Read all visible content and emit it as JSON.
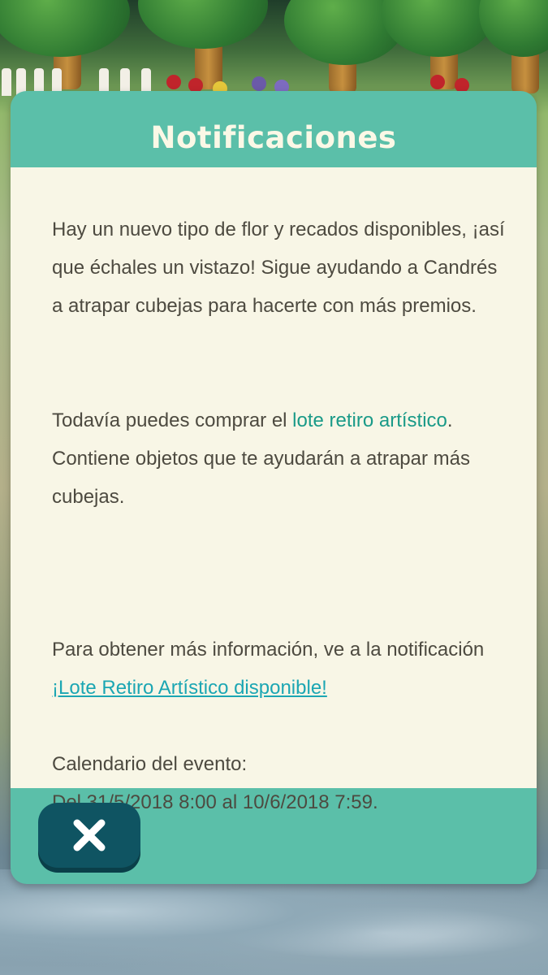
{
  "dialog": {
    "title": "Notificaciones",
    "paragraph1": "Hay un nuevo tipo de flor y recados disponibles, ¡así que échales un vistazo! Sigue ayudando a Candrés a atrapar cubejas para hacerte con más premios.",
    "paragraph2": {
      "before": "Todavía puedes comprar el ",
      "link": "lote retiro artístico",
      "after": ". Contiene objetos que te ayudarán a atrapar más cubejas."
    },
    "paragraph3": {
      "before": "Para obtener más información, ve a la notificación ",
      "link": "¡Lote Retiro Artístico disponible!"
    },
    "schedule_label": "Calendario del evento:",
    "schedule_dates": "Del 31/5/2018 8:00 al 10/6/2018 7:59."
  },
  "footer": {
    "close_icon": "close-icon"
  },
  "colors": {
    "frame": "#5bbfa9",
    "panel": "#f8f6e6",
    "text": "#4d4a40",
    "link_green": "#1a9a88",
    "link_blue": "#1ba6b3",
    "close_button": "#0f5462"
  }
}
